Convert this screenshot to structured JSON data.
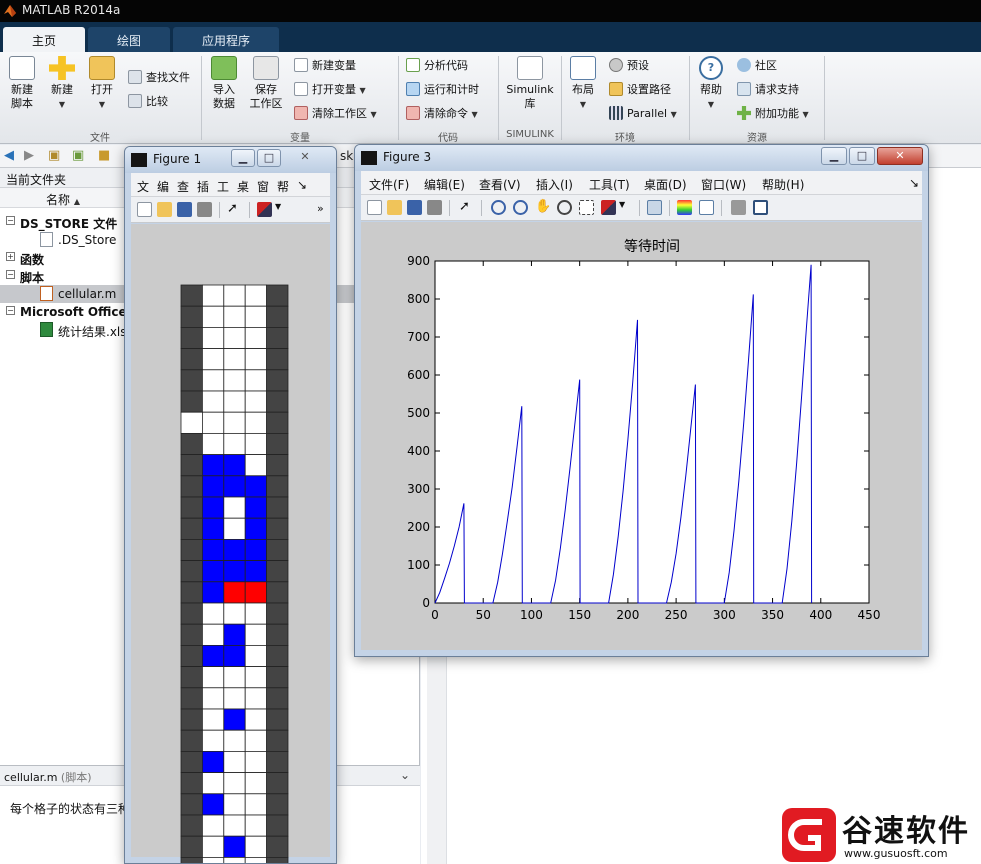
{
  "window": {
    "title": "MATLAB R2014a"
  },
  "tabs": [
    {
      "label": "主页",
      "active": true
    },
    {
      "label": "绘图",
      "active": false
    },
    {
      "label": "应用程序",
      "active": false
    }
  ],
  "ribbon": {
    "file": {
      "new_script": "新建\n脚本",
      "new": "新建",
      "open": "打开",
      "find_files": "查找文件",
      "compare": "比较",
      "group_label": "文件"
    },
    "variable": {
      "import_data": "导入\n数据",
      "save_workspace": "保存\n工作区",
      "new_variable": "新建变量",
      "open_variable": "打开变量",
      "clear_workspace": "清除工作区",
      "group_label": "变量"
    },
    "code": {
      "analyze_code": "分析代码",
      "run_and_time": "运行和计时",
      "clear_commands": "清除命令",
      "group_label": "代码"
    },
    "simulink": {
      "library": "Simulink\n库",
      "group_label": "SIMULINK"
    },
    "environment": {
      "layout": "布局",
      "preferences": "预设",
      "set_path": "设置路径",
      "parallel": "Parallel",
      "group_label": "环境"
    },
    "resources": {
      "help": "帮助",
      "community": "社区",
      "request_support": "请求支持",
      "add_ons": "附加功能",
      "group_label": "资源"
    }
  },
  "pathbar": {
    "fragment": "sk"
  },
  "file_panel": {
    "title": "当前文件夹",
    "column_name": "名称",
    "groups": [
      {
        "label": "DS_STORE 文件",
        "files": [
          ".DS_Store"
        ]
      },
      {
        "label": "函数",
        "files": []
      },
      {
        "label": "脚本",
        "files": [
          "cellular.m"
        ]
      },
      {
        "label": "Microsoft Office",
        "files": [
          "统计结果.xls"
        ]
      }
    ]
  },
  "detail_panel": {
    "file": "cellular.m",
    "kind": "(脚本)",
    "text": "每个格子的状态有三种"
  },
  "figure1": {
    "title": "Figure 1",
    "menu": [
      "文",
      "编",
      "查",
      "插",
      "工",
      "桌",
      "窗",
      "帮",
      "↘"
    ],
    "grid": {
      "rows": 28,
      "cols": 5,
      "colors": {
        "0": "#ffffff",
        "1": "#0000ff",
        "2": "#ff0000",
        "3": "#444444"
      },
      "cells": [
        [
          3,
          0,
          0,
          0,
          3
        ],
        [
          3,
          0,
          0,
          0,
          3
        ],
        [
          3,
          0,
          0,
          0,
          3
        ],
        [
          3,
          0,
          0,
          0,
          3
        ],
        [
          3,
          0,
          0,
          0,
          3
        ],
        [
          3,
          0,
          0,
          0,
          3
        ],
        [
          0,
          0,
          0,
          0,
          3
        ],
        [
          3,
          0,
          0,
          0,
          3
        ],
        [
          3,
          1,
          1,
          0,
          3
        ],
        [
          3,
          1,
          1,
          1,
          3
        ],
        [
          3,
          1,
          0,
          1,
          3
        ],
        [
          3,
          1,
          0,
          1,
          3
        ],
        [
          3,
          1,
          1,
          1,
          3
        ],
        [
          3,
          1,
          1,
          1,
          3
        ],
        [
          3,
          1,
          2,
          2,
          3
        ],
        [
          3,
          0,
          0,
          0,
          3
        ],
        [
          3,
          0,
          1,
          0,
          3
        ],
        [
          3,
          1,
          1,
          0,
          3
        ],
        [
          3,
          0,
          0,
          0,
          3
        ],
        [
          3,
          0,
          0,
          0,
          3
        ],
        [
          3,
          0,
          1,
          0,
          3
        ],
        [
          3,
          0,
          0,
          0,
          3
        ],
        [
          3,
          1,
          0,
          0,
          3
        ],
        [
          3,
          0,
          0,
          0,
          3
        ],
        [
          3,
          1,
          0,
          0,
          3
        ],
        [
          3,
          0,
          0,
          0,
          3
        ],
        [
          3,
          0,
          1,
          0,
          3
        ],
        [
          3,
          0,
          0,
          0,
          3
        ]
      ]
    }
  },
  "figure3": {
    "title": "Figure 3",
    "menu": [
      "文件(F)",
      "编辑(E)",
      "查看(V)",
      "插入(I)",
      "工具(T)",
      "桌面(D)",
      "窗口(W)",
      "帮助(H)",
      "↘"
    ],
    "tick_labels_x": [
      "0",
      "50",
      "100",
      "150",
      "200",
      "250",
      "300",
      "350",
      "400",
      "450"
    ],
    "tick_labels_y": [
      "0",
      "100",
      "200",
      "300",
      "400",
      "500",
      "600",
      "700",
      "800",
      "900"
    ]
  },
  "chart_data": {
    "type": "line",
    "title": "等待时间",
    "xlabel": "",
    "ylabel": "",
    "xlim": [
      0,
      450
    ],
    "ylim": [
      0,
      900
    ],
    "grid": false,
    "line_color": "#0000cc",
    "series": [
      {
        "x": [
          0,
          5,
          10,
          15,
          20,
          25,
          30,
          30.5,
          60,
          65,
          70,
          75,
          80,
          85,
          90,
          90.5,
          120,
          125,
          130,
          135,
          140,
          145,
          150,
          150.5,
          180,
          185,
          190,
          195,
          200,
          205,
          210,
          210.5,
          240,
          245,
          250,
          255,
          260,
          265,
          270,
          270.5,
          300,
          305,
          310,
          315,
          320,
          325,
          330,
          330.5,
          360,
          365,
          370,
          375,
          380,
          385,
          390,
          390.5
        ],
        "y": [
          0,
          28,
          65,
          105,
          150,
          200,
          262,
          0,
          0,
          55,
          130,
          215,
          305,
          410,
          518,
          0,
          0,
          60,
          145,
          245,
          355,
          470,
          588,
          0,
          0,
          75,
          175,
          295,
          430,
          580,
          745,
          0,
          0,
          55,
          130,
          225,
          335,
          455,
          575,
          0,
          0,
          80,
          190,
          320,
          470,
          635,
          812,
          0,
          0,
          90,
          215,
          370,
          540,
          720,
          890,
          0
        ]
      }
    ]
  },
  "watermark": {
    "brand": "谷速软件",
    "url": "www.gusuosft.com"
  }
}
